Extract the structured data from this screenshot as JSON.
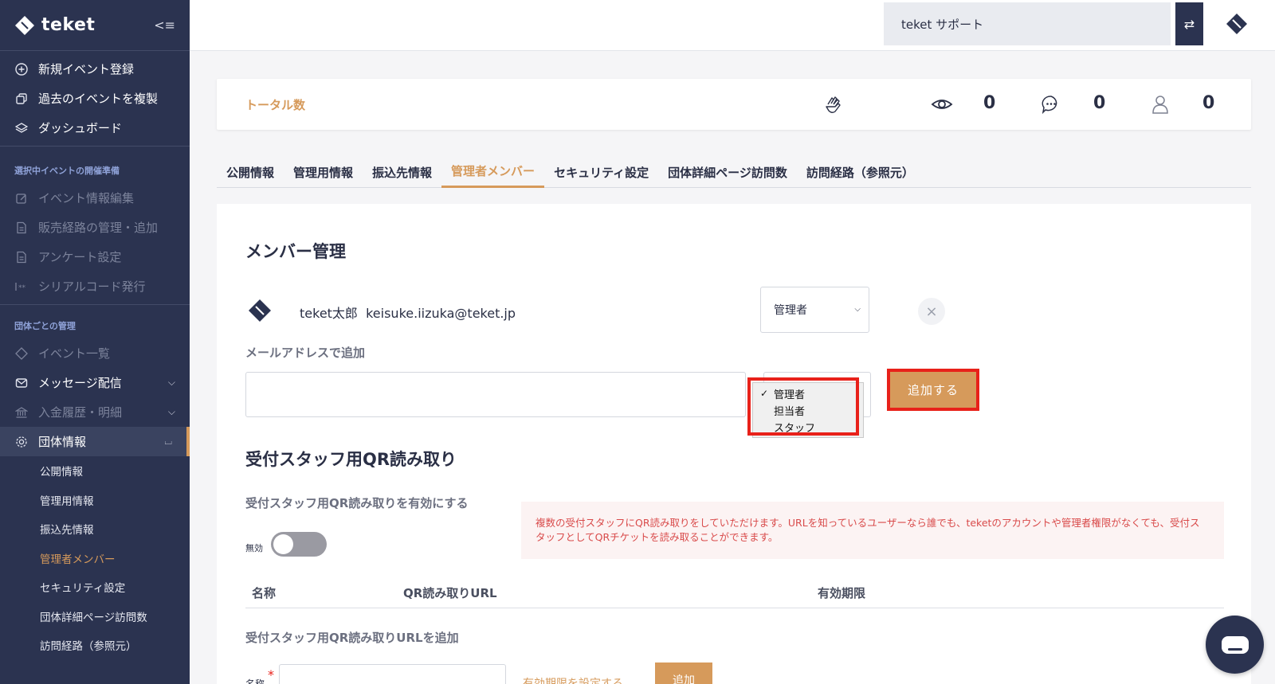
{
  "brand": {
    "name": "teket",
    "accent": "#d69a5b",
    "sidebar_bg": "#2b3350",
    "highlight": "#e8211a"
  },
  "sidebar": {
    "top_items": [
      {
        "label": "新規イベント登録",
        "icon": "plus-circle-icon"
      },
      {
        "label": "過去のイベントを複製",
        "icon": "copy-icon"
      },
      {
        "label": "ダッシュボード",
        "icon": "layers-icon"
      }
    ],
    "section1_label": "選択中イベントの開催準備",
    "section1_items": [
      {
        "label": "イベント情報編集",
        "icon": "edit-icon"
      },
      {
        "label": "販売経路の管理・追加",
        "icon": "document-icon"
      },
      {
        "label": "アンケート設定",
        "icon": "document-icon"
      },
      {
        "label": "シリアルコード発行",
        "icon": "serial-code-icon"
      }
    ],
    "section2_label": "団体ごとの管理",
    "section2_items": [
      {
        "label": "イベント一覧",
        "icon": "ticket-icon"
      },
      {
        "label": "メッセージ配信",
        "icon": "mail-icon"
      },
      {
        "label": "入金履歴・明細",
        "icon": "bank-icon"
      },
      {
        "label": "団体情報",
        "icon": "gear-icon"
      }
    ],
    "sub_items": [
      "公開情報",
      "管理用情報",
      "振込先情報",
      "管理者メンバー",
      "セキュリティ設定",
      "団体詳細ページ訪問数",
      "訪問経路（参照元）"
    ]
  },
  "topbar": {
    "org_name": "teket サポート"
  },
  "totals": {
    "title": "トータル数",
    "views": "0",
    "comments": "0",
    "users": "0"
  },
  "tabs": [
    "公開情報",
    "管理用情報",
    "振込先情報",
    "管理者メンバー",
    "セキュリティ設定",
    "団体詳細ページ訪問数",
    "訪問経路（参照元）"
  ],
  "members": {
    "heading": "メンバー管理",
    "member_name": "teket太郎",
    "member_email": "keisuke.iizuka@teket.jp",
    "member_role": "管理者",
    "add_label": "メールアドレスで追加",
    "role_options": [
      "管理者",
      "担当者",
      "スタッフ"
    ],
    "add_button": "追加する"
  },
  "qr": {
    "heading": "受付スタッフ用QR読み取り",
    "enable_label": "受付スタッフ用QR読み取りを有効にする",
    "toggle_state": "無効",
    "notice": "複数の受付スタッフにQR読み取りをしていただけます。URLを知っているユーザーなら誰でも、teketのアカウントや管理者権限がなくても、受付スタッフとしてQRチケットを読み取ることができます。",
    "columns": [
      "名称",
      "QR読み取りURL",
      "有効期限"
    ],
    "add_url_label": "受付スタッフ用QR読み取りURLを追加",
    "name_label": "名称",
    "expiry_link": "有効期限を設定する",
    "add_button": "追加"
  }
}
